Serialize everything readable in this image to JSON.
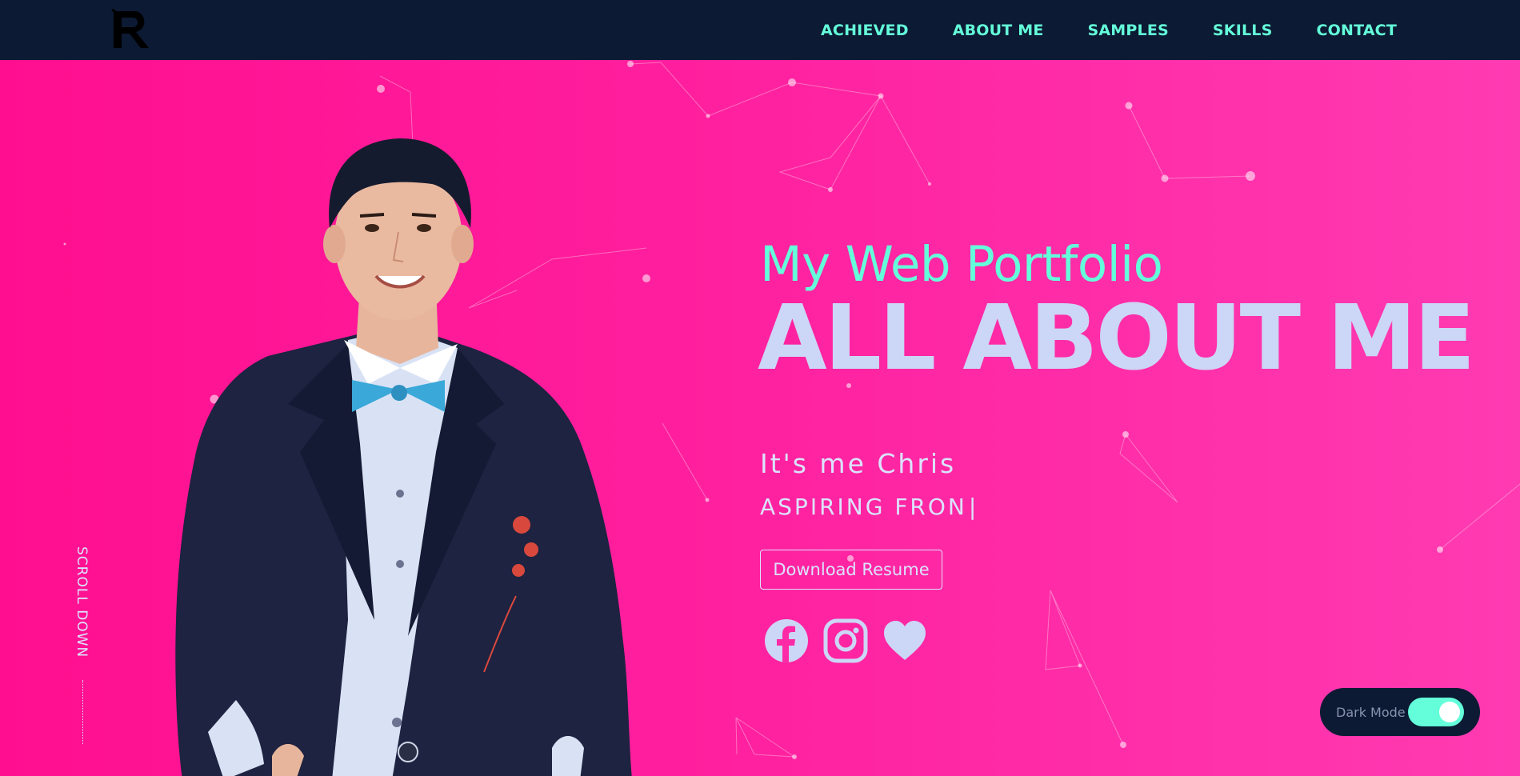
{
  "nav": {
    "logo_icon": "r-logo-icon",
    "links": [
      {
        "label": "ACHIEVED"
      },
      {
        "label": "ABOUT ME"
      },
      {
        "label": "SAMPLES"
      },
      {
        "label": "SKILLS"
      },
      {
        "label": "CONTACT"
      }
    ]
  },
  "hero": {
    "subtitle": "My Web Portfolio",
    "title": "ALL ABOUT ME",
    "intro": "It's me Chris",
    "role_typing": "ASPIRING FRON",
    "caret": "|",
    "resume_label": "Download Resume",
    "scroll_label": "SCROLL DOWN",
    "socials": [
      {
        "icon": "facebook-icon"
      },
      {
        "icon": "instagram-icon"
      },
      {
        "icon": "heart-icon"
      }
    ]
  },
  "dark_mode": {
    "label": "Dark Mode",
    "enabled": true
  },
  "colors": {
    "accent": "#64ffda",
    "navy": "#0c1a33",
    "light_text": "#ccd6f6",
    "background": "#ff1493"
  }
}
